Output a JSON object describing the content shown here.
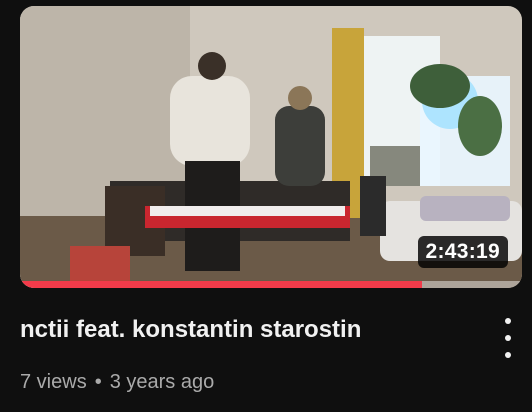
{
  "video": {
    "title": "nctii feat. konstantin starostin",
    "views": "7 views",
    "separator": "•",
    "age": "3 years ago",
    "duration": "2:43:19",
    "progress_fraction": 0.8
  },
  "icons": {
    "menu": "more-vert-icon"
  },
  "colors": {
    "background": "#0f0f0f",
    "progress": "#f23b4a",
    "meta_text": "#aaaaaa"
  }
}
